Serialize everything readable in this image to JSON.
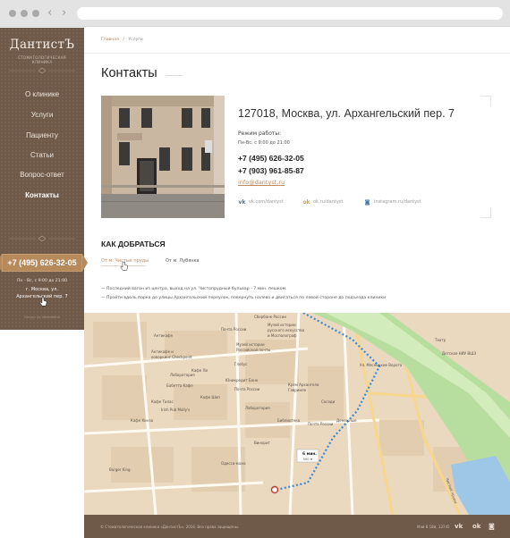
{
  "site": {
    "logo": "ДантистЪ",
    "logo_sub": "СТОМАТОЛОГИЧЕСКАЯ КЛИНИКА"
  },
  "menu": [
    {
      "label": "О клинике"
    },
    {
      "label": "Услуги"
    },
    {
      "label": "Пациенту"
    },
    {
      "label": "Статьи"
    },
    {
      "label": "Вопрос-ответ"
    },
    {
      "label": "Контакты",
      "active": true
    }
  ],
  "sidebar": {
    "phone": "+7 (495) 626-32-05",
    "hours_line1": "Пн - Вс, с 9:00 до 21:00",
    "addr_line1": "г. Москва, ул.",
    "addr_line2": "Архангельский пер. 7",
    "credit": "Design by Webdefine"
  },
  "breadcrumb": {
    "home": "Главная",
    "separator": "/",
    "current": "Услуги"
  },
  "page": {
    "title": "Контакты",
    "address": "127018, Москва, ул. Архангельский пер. 7",
    "hours_title": "Режим работы:",
    "hours": "Пн-Вс, с 9:00 до 21:00",
    "phone1": "+7 (495) 626-32-05",
    "phone2": "+7 (903) 961-85-87",
    "email": "info@dantyst.ru",
    "social": [
      {
        "icon": "vk-icon",
        "glyph": "vk",
        "label": "vk.com/dantyst",
        "color": "#4c75a3"
      },
      {
        "icon": "odnoklassniki-icon",
        "glyph": "ok",
        "label": "ok.ru/dantyst",
        "color": "#f39b21"
      },
      {
        "icon": "instagram-icon",
        "glyph": "◙",
        "label": "instagram.ru/dantyst",
        "color": "#3f729b"
      }
    ]
  },
  "directions": {
    "title": "КАК ДОБРАТЬСЯ",
    "tabs": [
      {
        "label": "От м. Чистые пруды",
        "active": true
      },
      {
        "label": "От м. Лубянка",
        "active": false
      }
    ],
    "steps": [
      "—   Последний вагон из центра, выход на ул. Чистопрудный бульвар - 7 мин. пешком.",
      "—   Пройти вдоль парка до улицы Архангельский переулок, повернуть налево и двигаться по левой стороне до подъезда клиники"
    ]
  },
  "map": {
    "labels": [
      "Сбербанк России",
      "Почта России",
      "Антикафе",
      "Музей истории",
      "русского искусства",
      "и Мосполограф",
      "Музей истории",
      "Российской почты",
      "Антикафе и",
      "коворкинг Checkpoint",
      "Кафе Ли",
      "Глобус",
      "Лаборатория",
      "Бабетта Кафе",
      "Юникредит Банк",
      "Кофе Шоп",
      "Почта России",
      "Кафе Тилас",
      "Irish Pub Molly's",
      "Кафе Кинза",
      "Крем Архангела",
      "Гаврииля",
      "Соседи",
      "Ул. Мясницкие Ворота",
      "Денежные",
      "Почта России",
      "Лаборатория",
      "Библиотека",
      "Винорит",
      "Одесса-мама",
      "Burger King",
      "Детская НИУ ВШЭ",
      "Театр",
      "Чистые пруды"
    ],
    "walk_time": "6 мин.",
    "walk_distance": "500 м"
  },
  "footer": {
    "copyright": "© Стоматологическая клиника «ДантистЪ», 2016. Все права защищены.",
    "credit": "Май 8 18й, 13745"
  }
}
